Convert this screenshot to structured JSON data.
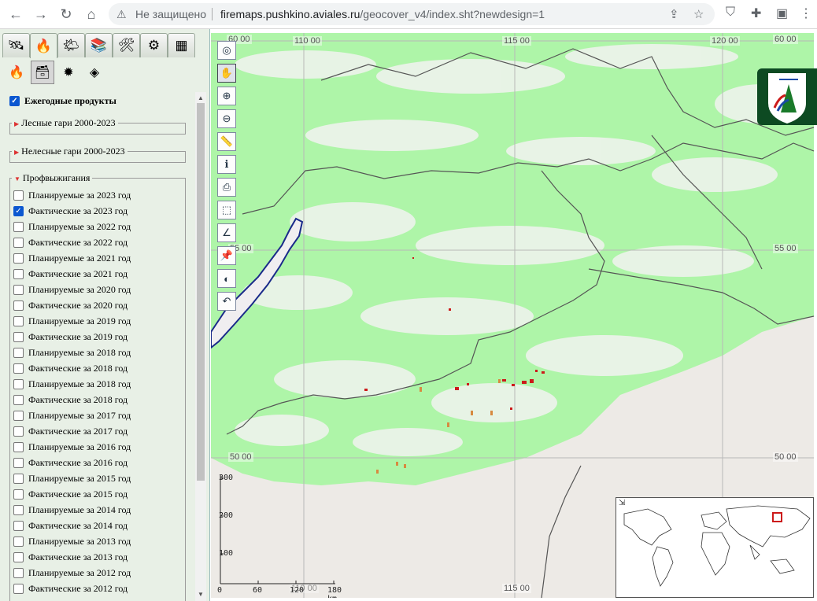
{
  "browser": {
    "security_text": "Не защищено",
    "url_host": "firemaps.pushkino.aviales.ru",
    "url_path": "/geocover_v4/index.sht?newdesign=1"
  },
  "panel": {
    "main_tabs": [
      {
        "icon": "satellite-icon",
        "glyph": "🛰"
      },
      {
        "icon": "fire-icon",
        "glyph": "🔥"
      },
      {
        "icon": "weather-icon",
        "glyph": "🌤"
      },
      {
        "icon": "layers-icon",
        "glyph": "📚"
      },
      {
        "icon": "tools-icon",
        "glyph": "🛠"
      },
      {
        "icon": "gear-icon",
        "glyph": "⚙"
      },
      {
        "icon": "table-icon",
        "glyph": "▦"
      }
    ],
    "sub_tabs": [
      {
        "icon": "flame-icon",
        "glyph": "🔥"
      },
      {
        "icon": "burned-product-icon",
        "glyph": "🗃"
      },
      {
        "icon": "hotspot-icon",
        "glyph": "✹"
      },
      {
        "icon": "layer-stack-icon",
        "glyph": "◈"
      }
    ],
    "yearly_label": "Ежегодные продукты",
    "yearly_checked": true,
    "forest_group": "Лесные гари 2000-2023",
    "nonforest_group": "Нелесные гари 2000-2023",
    "prescribed_group": "Профвыжигания",
    "prescribed_items": [
      {
        "label": "Планируемые за 2023 год",
        "checked": false
      },
      {
        "label": "Фактические за 2023 год",
        "checked": true
      },
      {
        "label": "Планируемые за 2022 год",
        "checked": false
      },
      {
        "label": "Фактические за 2022 год",
        "checked": false
      },
      {
        "label": "Планируемые за 2021 год",
        "checked": false
      },
      {
        "label": "Фактические за 2021 год",
        "checked": false
      },
      {
        "label": "Планируемые за 2020 год",
        "checked": false
      },
      {
        "label": "Фактические за 2020 год",
        "checked": false
      },
      {
        "label": "Планируемые за 2019 год",
        "checked": false
      },
      {
        "label": "Фактические за 2019 год",
        "checked": false
      },
      {
        "label": "Планируемые за 2018 год",
        "checked": false
      },
      {
        "label": "Фактические за 2018 год",
        "checked": false
      },
      {
        "label": "Планируемые за 2018 год",
        "checked": false
      },
      {
        "label": "Фактические за 2018 год",
        "checked": false
      },
      {
        "label": "Планируемые за 2017 год",
        "checked": false
      },
      {
        "label": "Фактические за 2017 год",
        "checked": false
      },
      {
        "label": "Планируемые за 2016 год",
        "checked": false
      },
      {
        "label": "Фактические за 2016 год",
        "checked": false
      },
      {
        "label": "Планируемые за 2015 год",
        "checked": false
      },
      {
        "label": "Фактические за 2015 год",
        "checked": false
      },
      {
        "label": "Планируемые за 2014 год",
        "checked": false
      },
      {
        "label": "Фактические за 2014 год",
        "checked": false
      },
      {
        "label": "Планируемые за 2013 год",
        "checked": false
      },
      {
        "label": "Фактические за 2013 год",
        "checked": false
      },
      {
        "label": "Планируемые за 2012 год",
        "checked": false
      },
      {
        "label": "Фактические за 2012 год",
        "checked": false
      }
    ]
  },
  "map": {
    "coords": {
      "lon_110": "110 00",
      "lon_115_top": "115 00",
      "lon_120": "120 00",
      "lat_60_left": "60 00",
      "lat_60_right": "60 00",
      "lat_55_left": "55 00",
      "lat_55_right": "55 00",
      "lat_50_left": "50 00",
      "lat_50_right": "50 00",
      "lon_115_bottom": "115 00",
      "lon_110_bottom": "110 00"
    },
    "scale": {
      "y_ticks": [
        "300",
        "200",
        "100"
      ],
      "x_ticks": [
        "0",
        "60",
        "120",
        "180 km"
      ]
    },
    "tools": [
      "zoom-extent-icon",
      "pan-hand-icon",
      "zoom-in-icon",
      "zoom-out-icon",
      "ruler-icon",
      "info-icon",
      "print-icon",
      "select-area-icon",
      "measure-angle-icon",
      "pin-icon",
      "globe-icon",
      "undo-icon"
    ],
    "colors": {
      "vegetation": "#aef5a8",
      "bare": "#edeae6",
      "water": "#1a2a8a",
      "border": "#555555",
      "fire": "#cc1a1a"
    }
  }
}
